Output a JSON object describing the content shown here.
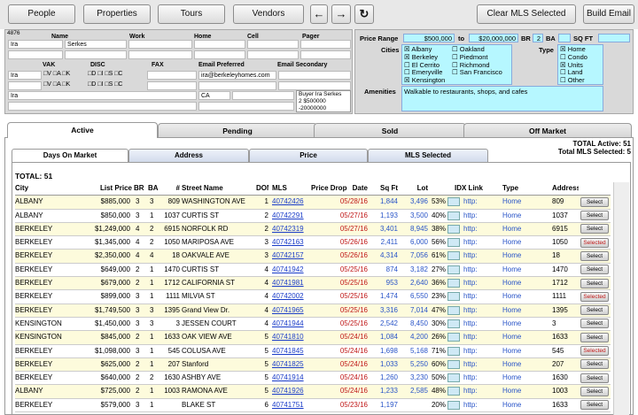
{
  "toolbar": {
    "people": "People",
    "properties": "Properties",
    "tours": "Tours",
    "vendors": "Vendors",
    "clear_mls": "Clear MLS Selected",
    "build_email": "Build Email"
  },
  "contact": {
    "id": "4876",
    "name_label": "Name",
    "work_label": "Work",
    "home_label": "Home",
    "cell_label": "Cell",
    "pager_label": "Pager",
    "first_name": "Ira",
    "last_name": "Serkes",
    "vak_label": "VAK",
    "disc_label": "DISC",
    "fax_label": "FAX",
    "email_pref_label": "Email Preferred",
    "email_sec_label": "Email Secondary",
    "vak_row1": "Ira",
    "vak_opts": "□V □A □K",
    "disc_opts": "□D □I □S □C",
    "email_pref": "ira@berkeleyhomes.com",
    "addr_name": "Ira",
    "state": "CA",
    "buyer_line1": "Buyer  Ira Serkes",
    "buyer_line2": "2 $500000",
    "buyer_line3": "-20000000"
  },
  "search": {
    "price_range_label": "Price Range",
    "price_min": "$500,000",
    "to_label": "to",
    "price_max": "$20,000,000",
    "br_label": "BR",
    "br_value": "2",
    "ba_label": "BA",
    "sqft_label": "SQ FT",
    "cities_label": "Cities",
    "cities_col1": [
      "☒ Albany",
      "☒ Berkeley",
      "☐ El Cerrito",
      "☐ Emeryville",
      "☒ Kensington"
    ],
    "cities_col2": [
      "☐ Oakland",
      "☐ Piedmont",
      "☐ Richmond",
      "☐ San Francisco"
    ],
    "type_label": "Type",
    "types": [
      "☒ Home",
      "☐ Condo",
      "☒ Units",
      "☐ Land",
      "☐ Other"
    ],
    "amenities_label": "Amenities",
    "amenities_value": "Walkable to restaurants, shops, and cafes"
  },
  "tabs": [
    "Active",
    "Pending",
    "Sold",
    "Off Market"
  ],
  "subtabs": [
    "Days On Market",
    "Address",
    "Price",
    "MLS Selected"
  ],
  "totals": {
    "active": "TOTAL Active: 51",
    "mls_selected": "Total MLS Selected: 5",
    "total": "TOTAL: 51"
  },
  "table": {
    "headers": [
      "City",
      "List Price",
      "BR",
      "BA",
      "#",
      "Street Name",
      "DOM",
      "MLS",
      "Price Drop",
      "Date",
      "Sq Ft",
      "Lot",
      "IDX Link",
      "Type",
      "Address"
    ],
    "rows": [
      [
        "ALBANY",
        "$885,000",
        "3",
        "3",
        "809",
        "WASHINGTON AVE",
        "1",
        "40742426",
        "",
        "05/28/16",
        "1,844",
        "3,496",
        "53%",
        "http:",
        "Home",
        "809",
        "Select"
      ],
      [
        "ALBANY",
        "$850,000",
        "3",
        "1",
        "1037",
        "CURTIS ST",
        "2",
        "40742291",
        "",
        "05/27/16",
        "1,193",
        "3,500",
        "40%",
        "http:",
        "Home",
        "1037",
        "Select"
      ],
      [
        "BERKELEY",
        "$1,249,000",
        "4",
        "2",
        "6915",
        "NORFOLK RD",
        "2",
        "40742319",
        "",
        "05/27/16",
        "3,401",
        "8,945",
        "38%",
        "http:",
        "Home",
        "6915",
        "Select"
      ],
      [
        "BERKELEY",
        "$1,345,000",
        "4",
        "2",
        "1050",
        "MARIPOSA AVE",
        "3",
        "40742163",
        "",
        "05/26/16",
        "2,411",
        "6,000",
        "56%",
        "http:",
        "Home",
        "1050",
        "Selected"
      ],
      [
        "BERKELEY",
        "$2,350,000",
        "4",
        "4",
        "18",
        "OAKVALE AVE",
        "3",
        "40742157",
        "",
        "05/26/16",
        "4,314",
        "7,056",
        "61%",
        "http:",
        "Home",
        "18",
        "Select"
      ],
      [
        "BERKELEY",
        "$649,000",
        "2",
        "1",
        "1470",
        "CURTIS ST",
        "4",
        "40741942",
        "",
        "05/25/16",
        "874",
        "3,182",
        "27%",
        "http:",
        "Home",
        "1470",
        "Select"
      ],
      [
        "BERKELEY",
        "$679,000",
        "2",
        "1",
        "1712",
        "CALIFORNIA ST",
        "4",
        "40741981",
        "",
        "05/25/16",
        "953",
        "2,640",
        "36%",
        "http:",
        "Home",
        "1712",
        "Select"
      ],
      [
        "BERKELEY",
        "$899,000",
        "3",
        "1",
        "1111",
        "MILVIA ST",
        "4",
        "40742002",
        "",
        "05/25/16",
        "1,474",
        "6,550",
        "23%",
        "http:",
        "Home",
        "1111",
        "Selected"
      ],
      [
        "BERKELEY",
        "$1,749,500",
        "3",
        "3",
        "1395",
        "Grand View Dr.",
        "4",
        "40741965",
        "",
        "05/25/16",
        "3,316",
        "7,014",
        "47%",
        "http:",
        "Home",
        "1395",
        "Select"
      ],
      [
        "KENSINGTON",
        "$1,450,000",
        "3",
        "3",
        "3",
        "JESSEN COURT",
        "4",
        "40741944",
        "",
        "05/25/16",
        "2,542",
        "8,450",
        "30%",
        "http:",
        "Home",
        "3",
        "Select"
      ],
      [
        "KENSINGTON",
        "$845,000",
        "2",
        "1",
        "1633",
        "OAK VIEW AVE",
        "5",
        "40741810",
        "",
        "05/24/16",
        "1,084",
        "4,200",
        "26%",
        "http:",
        "Home",
        "1633",
        "Select"
      ],
      [
        "BERKELEY",
        "$1,098,000",
        "3",
        "1",
        "545",
        "COLUSA AVE",
        "5",
        "40741845",
        "",
        "05/24/16",
        "1,698",
        "5,168",
        "71%",
        "http:",
        "Home",
        "545",
        "Selected"
      ],
      [
        "BERKELEY",
        "$625,000",
        "2",
        "1",
        "207",
        "Stanford",
        "5",
        "40741825",
        "",
        "05/24/16",
        "1,033",
        "5,250",
        "60%",
        "http:",
        "Home",
        "207",
        "Select"
      ],
      [
        "BERKELEY",
        "$640,000",
        "2",
        "2",
        "1630",
        "ASHBY AVE",
        "5",
        "40741914",
        "",
        "05/24/16",
        "1,260",
        "3,230",
        "50%",
        "http:",
        "Home",
        "1630",
        "Select"
      ],
      [
        "ALBANY",
        "$725,000",
        "2",
        "1",
        "1003",
        "RAMONA AVE",
        "5",
        "40741926",
        "",
        "05/24/16",
        "1,233",
        "2,585",
        "48%",
        "http:",
        "Home",
        "1003",
        "Select"
      ],
      [
        "BERKELEY",
        "$579,000",
        "3",
        "1",
        "",
        "BLAKE ST",
        "6",
        "40741751",
        "",
        "05/23/16",
        "1,197",
        "",
        "20%",
        "http:",
        "Home",
        "1633",
        "Select"
      ]
    ]
  }
}
